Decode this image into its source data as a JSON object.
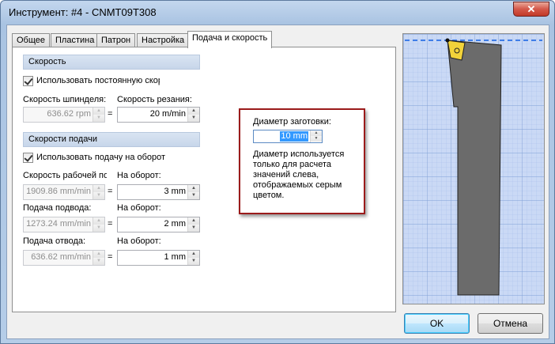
{
  "window": {
    "title": "Инструмент: #4 - CNMT09T308",
    "close_label": "✕"
  },
  "tabs": [
    {
      "label": "Общее"
    },
    {
      "label": "Пластина"
    },
    {
      "label": "Патрон"
    },
    {
      "label": "Настройка"
    },
    {
      "label": "Подача и скорость"
    }
  ],
  "speed": {
    "section_label": "Скорость",
    "constant_checkbox_label": "Использовать постоянную скорость",
    "constant_checked": true,
    "spindle_label": "Скорость шпинделя:",
    "spindle_value": "636.62 rpm",
    "cutting_label": "Скорость резания:",
    "cutting_value": "20 m/min",
    "equals": "="
  },
  "feed": {
    "section_label": "Скорости подачи",
    "per_rev_checkbox_label": "Использовать подачу на оборот",
    "per_rev_checked": true,
    "rows": [
      {
        "left_label": "Скорость рабочей подачи:",
        "left_value": "1909.86 mm/min",
        "right_label": "На оборот:",
        "right_value": "3 mm"
      },
      {
        "left_label": "Подача подвода:",
        "left_value": "1273.24 mm/min",
        "right_label": "На оборот:",
        "right_value": "2 mm"
      },
      {
        "left_label": "Подача отвода:",
        "left_value": "636.62 mm/min",
        "right_label": "На оборот:",
        "right_value": "1 mm"
      }
    ]
  },
  "diameter": {
    "label": "Диаметр заготовки:",
    "value": "10 mm",
    "note": "Диаметр используется только для расчета значений слева, отображаемых серым цветом."
  },
  "buttons": {
    "ok": "OK",
    "cancel": "Отмена"
  },
  "colors": {
    "insert": "#f2d33a",
    "holder": "#6b6b6b",
    "grid_bg": "#cad9f5",
    "dash_line": "#3f7ee8",
    "highlight_box": "#9b1b1b"
  }
}
